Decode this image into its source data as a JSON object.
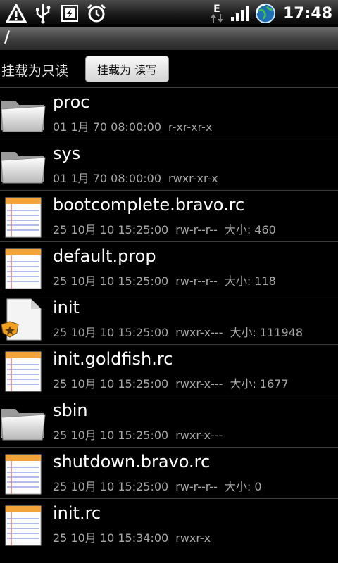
{
  "status_bar": {
    "network_letter": "E",
    "time": "17:48"
  },
  "path_bar": {
    "path": "/"
  },
  "mount": {
    "status_label": "挂载为只读",
    "button_label": "挂载为 读写"
  },
  "files": [
    {
      "name": "proc",
      "date": "01 1月 70 08:00:00",
      "perms": "r-xr-xr-x",
      "size": "",
      "icon": "folder-icon"
    },
    {
      "name": "sys",
      "date": "01 1月 70 08:00:00",
      "perms": "rwxr-xr-x",
      "size": "",
      "icon": "folder-icon"
    },
    {
      "name": "bootcomplete.bravo.rc",
      "date": "25 10月 10 15:25:00",
      "perms": "rw-r--r--",
      "size": "大小: 460",
      "icon": "text-file-icon"
    },
    {
      "name": "default.prop",
      "date": "25 10月 10 15:25:00",
      "perms": "rw-r--r--",
      "size": "大小: 118",
      "icon": "text-file-icon"
    },
    {
      "name": "init",
      "date": "25 10月 10 15:25:00",
      "perms": "rwxr-x---",
      "size": "大小: 111948",
      "icon": "executable-file-icon"
    },
    {
      "name": "init.goldfish.rc",
      "date": "25 10月 10 15:25:00",
      "perms": "rwxr-x---",
      "size": "大小: 1677",
      "icon": "text-file-icon"
    },
    {
      "name": "sbin",
      "date": "25 10月 10 15:25:00",
      "perms": "rwxr-x---",
      "size": "",
      "icon": "folder-icon"
    },
    {
      "name": "shutdown.bravo.rc",
      "date": "25 10月 10 15:25:00",
      "perms": "rw-r--r--",
      "size": "大小: 0",
      "icon": "text-file-icon"
    },
    {
      "name": "init.rc",
      "date": "25 10月 10 15:34:00",
      "perms": "rwxr-x",
      "size": "",
      "icon": "text-file-icon"
    }
  ]
}
